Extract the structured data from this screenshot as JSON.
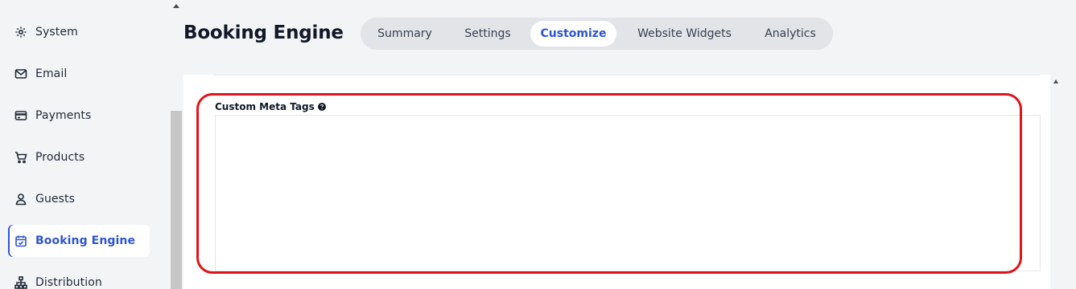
{
  "sidebar": {
    "items": [
      {
        "label": "System",
        "icon": "gear-icon"
      },
      {
        "label": "Email",
        "icon": "mail-icon"
      },
      {
        "label": "Payments",
        "icon": "credit-card-icon"
      },
      {
        "label": "Products",
        "icon": "cart-icon"
      },
      {
        "label": "Guests",
        "icon": "user-icon"
      },
      {
        "label": "Booking Engine",
        "icon": "calendar-check-icon",
        "active": true
      },
      {
        "label": "Distribution",
        "icon": "sitemap-icon"
      }
    ]
  },
  "header": {
    "title": "Booking Engine",
    "tabs": [
      {
        "label": "Summary"
      },
      {
        "label": "Settings"
      },
      {
        "label": "Customize",
        "active": true
      },
      {
        "label": "Website Widgets"
      },
      {
        "label": "Analytics"
      }
    ]
  },
  "form": {
    "custom_meta_tags_label": "Custom Meta Tags",
    "custom_meta_tags_value": ""
  },
  "colors": {
    "accent": "#2f55d4",
    "highlight": "#e0141b"
  }
}
